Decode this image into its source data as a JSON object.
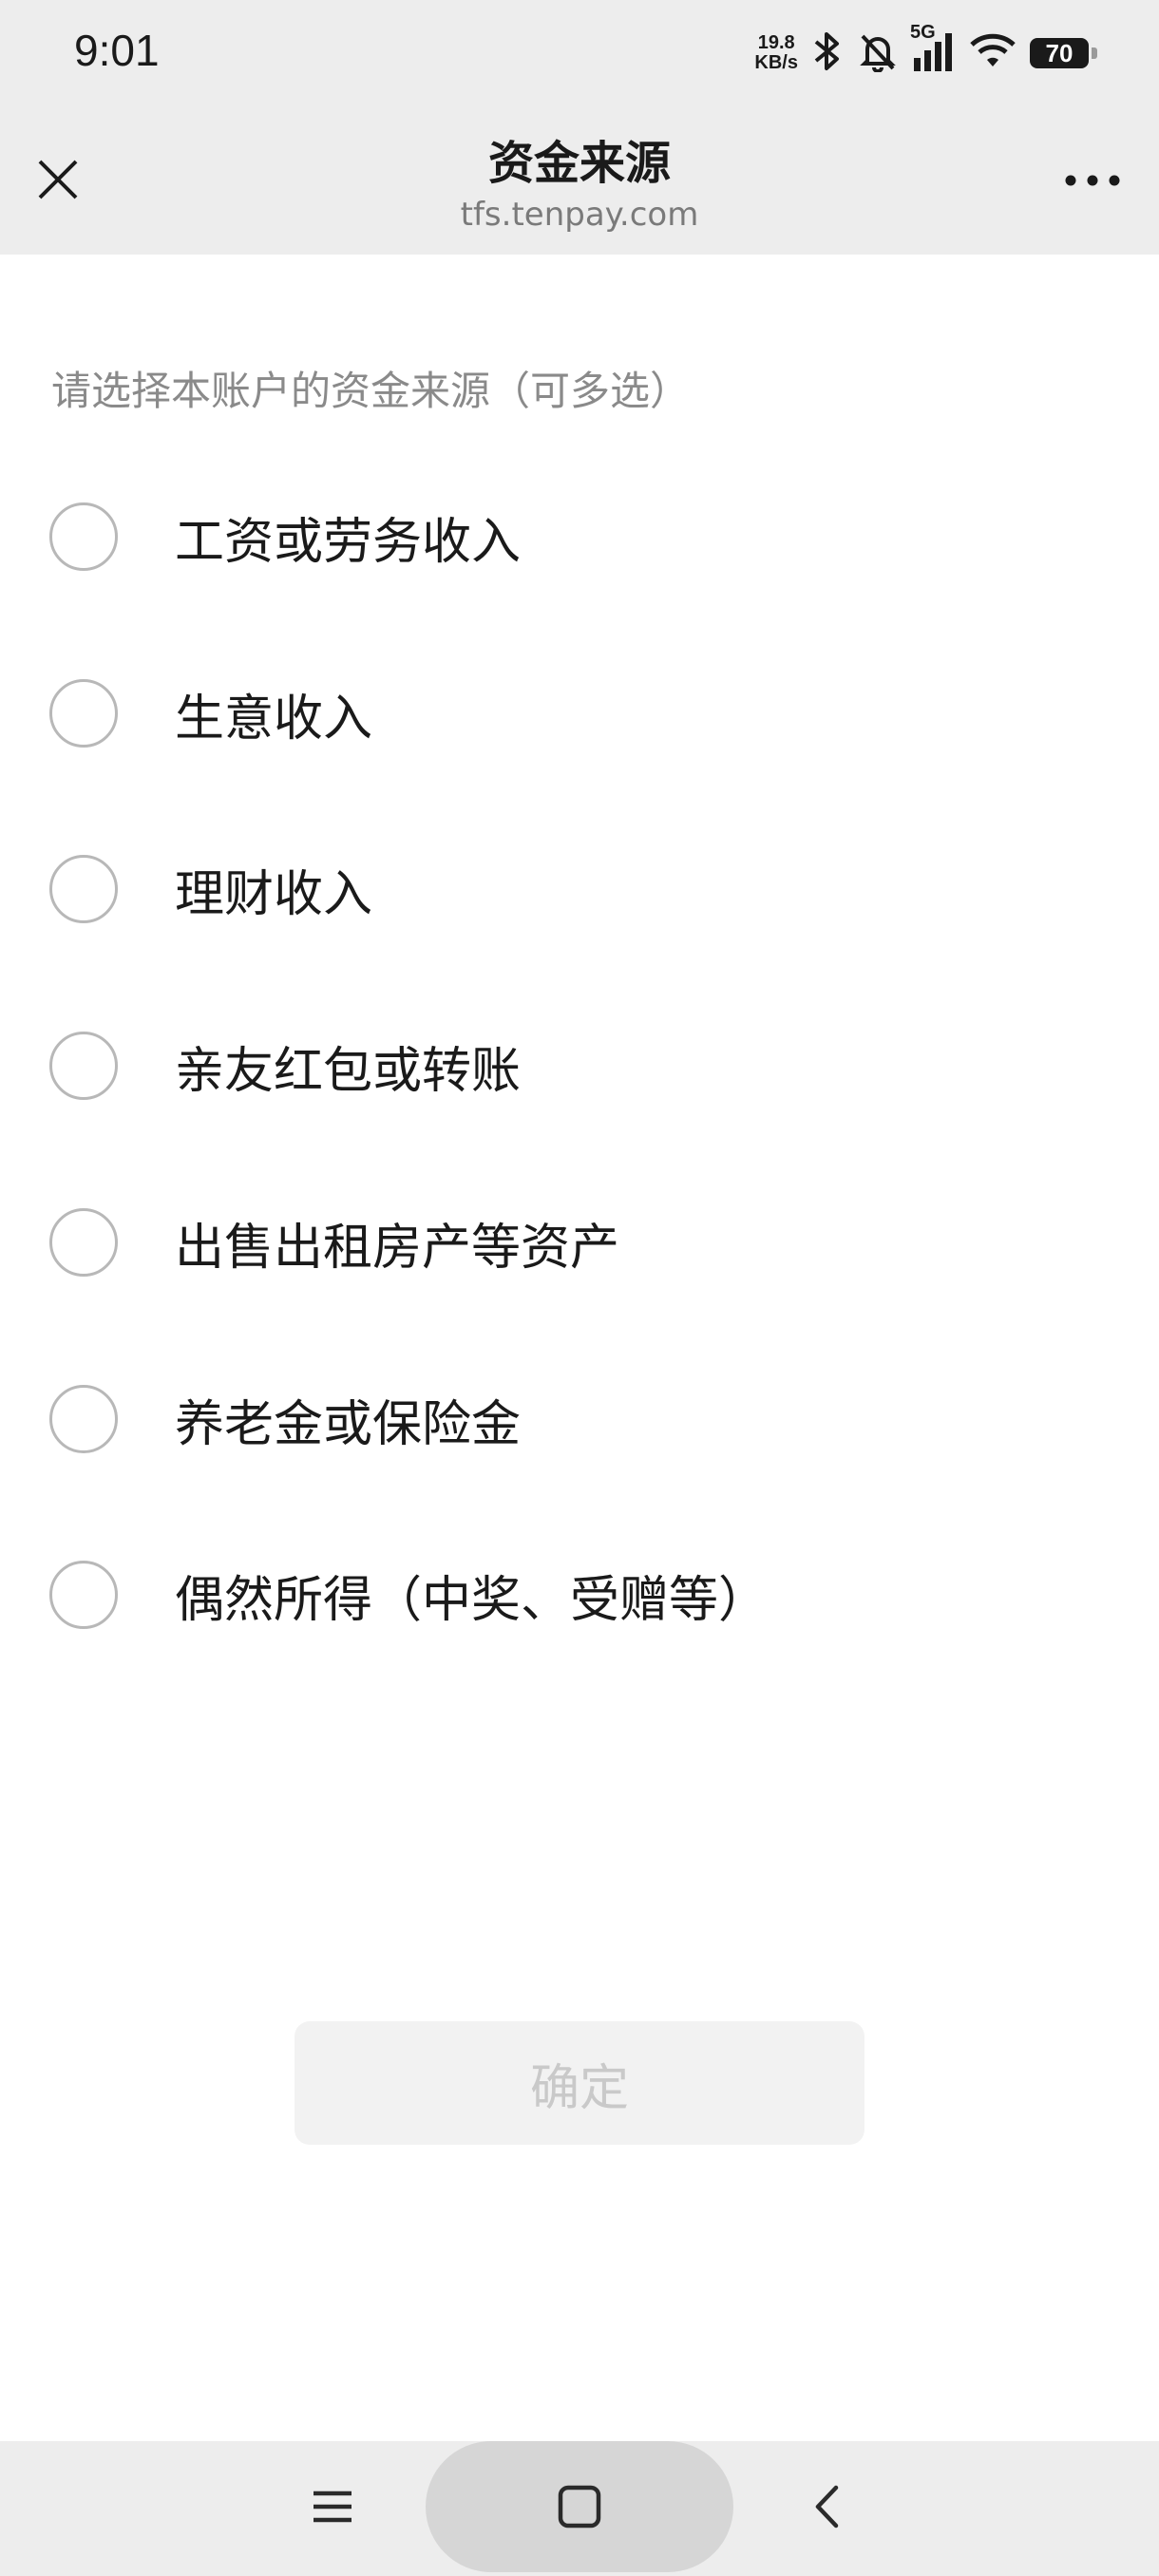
{
  "status_bar": {
    "time": "9:01",
    "net_speed_value": "19.8",
    "net_speed_unit": "KB/s",
    "network": "5G",
    "battery": "70",
    "icons": [
      "bluetooth-icon",
      "mute-bell-icon",
      "signal-icon",
      "wifi-icon",
      "battery-icon"
    ]
  },
  "header": {
    "title": "资金来源",
    "domain": "tfs.tenpay.com",
    "close_icon": "close-icon",
    "more_icon": "more-icon"
  },
  "hint": "请选择本账户的资金来源（可多选）",
  "options": [
    {
      "label": "工资或劳务收入",
      "checked": false
    },
    {
      "label": "生意收入",
      "checked": false
    },
    {
      "label": "理财收入",
      "checked": false
    },
    {
      "label": "亲友红包或转账",
      "checked": false
    },
    {
      "label": "出售出租房产等资产",
      "checked": false
    },
    {
      "label": "养老金或保险金",
      "checked": false
    },
    {
      "label": "偶然所得（中奖、受赠等）",
      "checked": false
    }
  ],
  "confirm_label": "确定",
  "nav": {
    "menu_icon": "menu-icon",
    "home_icon": "home-icon",
    "back_icon": "back-icon"
  },
  "colors": {
    "header_bg": "#ededed",
    "text": "#1a1a1a",
    "hint": "#8a8a8a",
    "radio_border": "#b8b8b8",
    "button_disabled_bg": "#f2f2f2",
    "button_disabled_text": "#c9c9c9"
  }
}
